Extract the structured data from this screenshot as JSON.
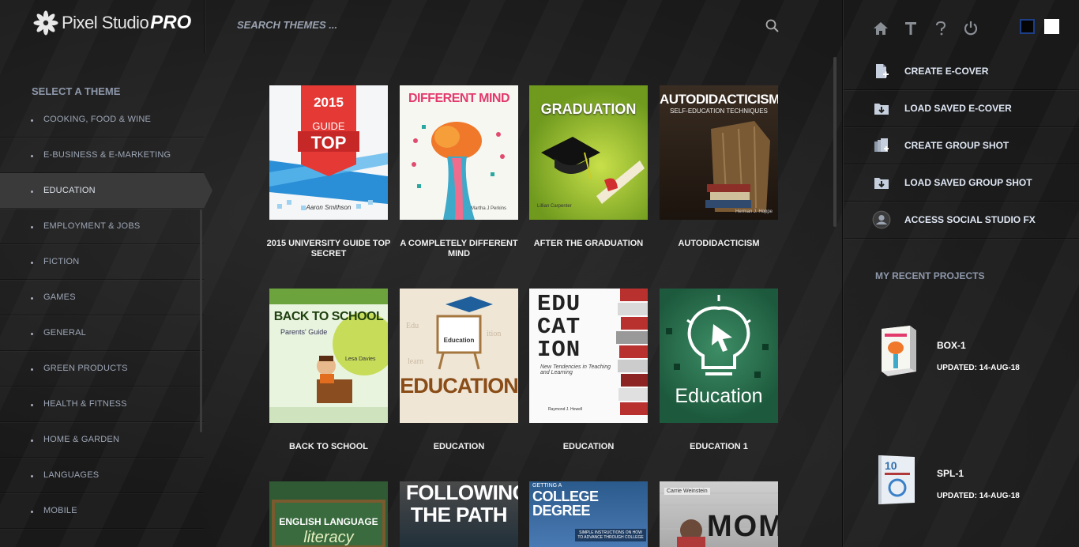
{
  "app": {
    "logo_text": "Pixel Studio",
    "logo_pro": "PRO"
  },
  "search": {
    "placeholder": "SEARCH THEMES ..."
  },
  "header_icons": [
    "home-icon",
    "text-icon",
    "help-icon",
    "power-icon"
  ],
  "swatches": [
    "#050505",
    "#ffffff"
  ],
  "sidebar": {
    "title": "SELECT A THEME",
    "items": [
      {
        "label": "COOKING, FOOD & WINE"
      },
      {
        "label": "E-BUSINESS & E-MARKETING"
      },
      {
        "label": "EDUCATION",
        "active": true
      },
      {
        "label": "EMPLOYMENT & JOBS"
      },
      {
        "label": "FICTION"
      },
      {
        "label": "GAMES"
      },
      {
        "label": "GENERAL"
      },
      {
        "label": "GREEN PRODUCTS"
      },
      {
        "label": "HEALTH & FITNESS"
      },
      {
        "label": "HOME & GARDEN"
      },
      {
        "label": "LANGUAGES"
      },
      {
        "label": "MOBILE"
      }
    ]
  },
  "themes": [
    {
      "title": "2015 UNIVERSITY GUIDE TOP SECRET",
      "cover": {
        "top": "2015",
        "mid": "GUIDE",
        "big": "TOP",
        "author": "Aaron Smithson"
      }
    },
    {
      "title": "A COMPLETELY DIFFERENT MIND",
      "cover": {
        "top": "DIFFERENT MIND",
        "author": "Martha J Perkins"
      }
    },
    {
      "title": "AFTER THE GRADUATION",
      "cover": {
        "top": "GRADUATION",
        "author": "Lillian Carpenter"
      }
    },
    {
      "title": "AUTODIDACTICISM",
      "cover": {
        "top": "AUTODIDACTICISM",
        "sub": "SELF-EDUCATION TECHNIQUES",
        "author": "Herman J. Hoppe"
      }
    },
    {
      "title": "BACK TO SCHOOL",
      "cover": {
        "top": "BACK TO SCHOOL",
        "sub": "Parents' Guide",
        "author": "Lesa Davies"
      }
    },
    {
      "title": "EDUCATION",
      "cover": {
        "top": "Education",
        "big": "EDUCATION"
      }
    },
    {
      "title": "EDUCATION",
      "cover": {
        "big": "EDU CAT ION",
        "sub": "New Tendencies in Teaching and Learning",
        "author": "Raymond J. Howell"
      }
    },
    {
      "title": "EDUCATION 1",
      "cover": {
        "big": "Education"
      }
    },
    {
      "title": "",
      "cover": {
        "top": "ENGLISH LANGUAGE",
        "big": "literacy"
      }
    },
    {
      "title": "",
      "cover": {
        "big": "FOLLOWING THE PATH"
      }
    },
    {
      "title": "",
      "cover": {
        "top": "GETTING A",
        "big": "COLLEGE DEGREE",
        "sub": "SIMPLE INSTRUCTIONS ON HOW TO ADVANCE THROUGH COLLEGE"
      }
    },
    {
      "title": "",
      "cover": {
        "top": "Carrie Weinstein",
        "big": "MOM"
      }
    }
  ],
  "actions": [
    {
      "label": "CREATE E-COVER",
      "icon": "new-file-icon"
    },
    {
      "label": "LOAD SAVED E-COVER",
      "icon": "load-folder-icon"
    },
    {
      "label": "CREATE GROUP SHOT",
      "icon": "group-files-icon"
    },
    {
      "label": "LOAD SAVED GROUP SHOT",
      "icon": "load-folder-icon"
    },
    {
      "label": "ACCESS SOCIAL STUDIO FX",
      "icon": "social-fx-icon"
    }
  ],
  "recent": {
    "title": "MY RECENT PROJECTS",
    "projects": [
      {
        "name": "BOX-1",
        "updated": "UPDATED: 14-AUG-18"
      },
      {
        "name": "SPL-1",
        "updated": "UPDATED: 14-AUG-18"
      }
    ]
  }
}
